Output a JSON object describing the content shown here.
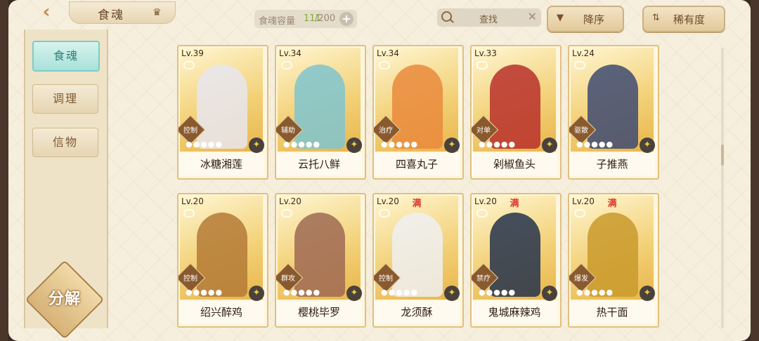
{
  "header": {
    "title": "食魂",
    "capacity_label": "食魂容量",
    "capacity_current": "111",
    "capacity_max": "/200",
    "search_placeholder": "查找",
    "sort_order_label": "降序",
    "sort_key_label": "稀有度"
  },
  "sidebar": {
    "items": [
      {
        "label": "食魂",
        "active": true
      },
      {
        "label": "调理",
        "active": false
      },
      {
        "label": "信物",
        "active": false
      }
    ],
    "decompose_label": "分解"
  },
  "cards": [
    {
      "level": "Lv.39",
      "name": "冰糖湘莲",
      "role": "控制",
      "stars": 0,
      "max": "",
      "color": "#e8e6f0"
    },
    {
      "level": "Lv.34",
      "name": "云托八鲜",
      "role": "辅助",
      "stars": 0,
      "max": "",
      "color": "#7fc4cf"
    },
    {
      "level": "Lv.34",
      "name": "四喜丸子",
      "role": "治疗",
      "stars": 0,
      "max": "",
      "color": "#e98a3c"
    },
    {
      "level": "Lv.33",
      "name": "剁椒鱼头",
      "role": "对单",
      "stars": 0,
      "max": "",
      "color": "#b8302b"
    },
    {
      "level": "Lv.24",
      "name": "子推燕",
      "role": "驱散",
      "stars": 0,
      "max": "",
      "color": "#3e4a72"
    },
    {
      "level": "Lv.20",
      "name": "绍兴醉鸡",
      "role": "控制",
      "stars": 0,
      "max": "",
      "color": "#b47a36"
    },
    {
      "level": "Lv.20",
      "name": "樱桃毕罗",
      "role": "群攻",
      "stars": 0,
      "max": "",
      "color": "#9f6a54"
    },
    {
      "level": "Lv.20",
      "name": "龙须酥",
      "role": "控制",
      "stars": 0,
      "max": "满",
      "color": "#eef0f2"
    },
    {
      "level": "Lv.20",
      "name": "鬼城麻辣鸡",
      "role": "禁疗",
      "stars": 0,
      "max": "满",
      "color": "#24334c"
    },
    {
      "level": "Lv.20",
      "name": "热干面",
      "role": "爆发",
      "stars": 0,
      "max": "满",
      "color": "#c99a2c"
    }
  ],
  "icons": {
    "back": "chevron-left-icon",
    "crown": "crown-icon",
    "search": "search-icon",
    "clear": "close-icon",
    "add": "plus-icon",
    "sort_order": "triangle-down-icon",
    "sort_key": "sort-arrows-icon"
  }
}
